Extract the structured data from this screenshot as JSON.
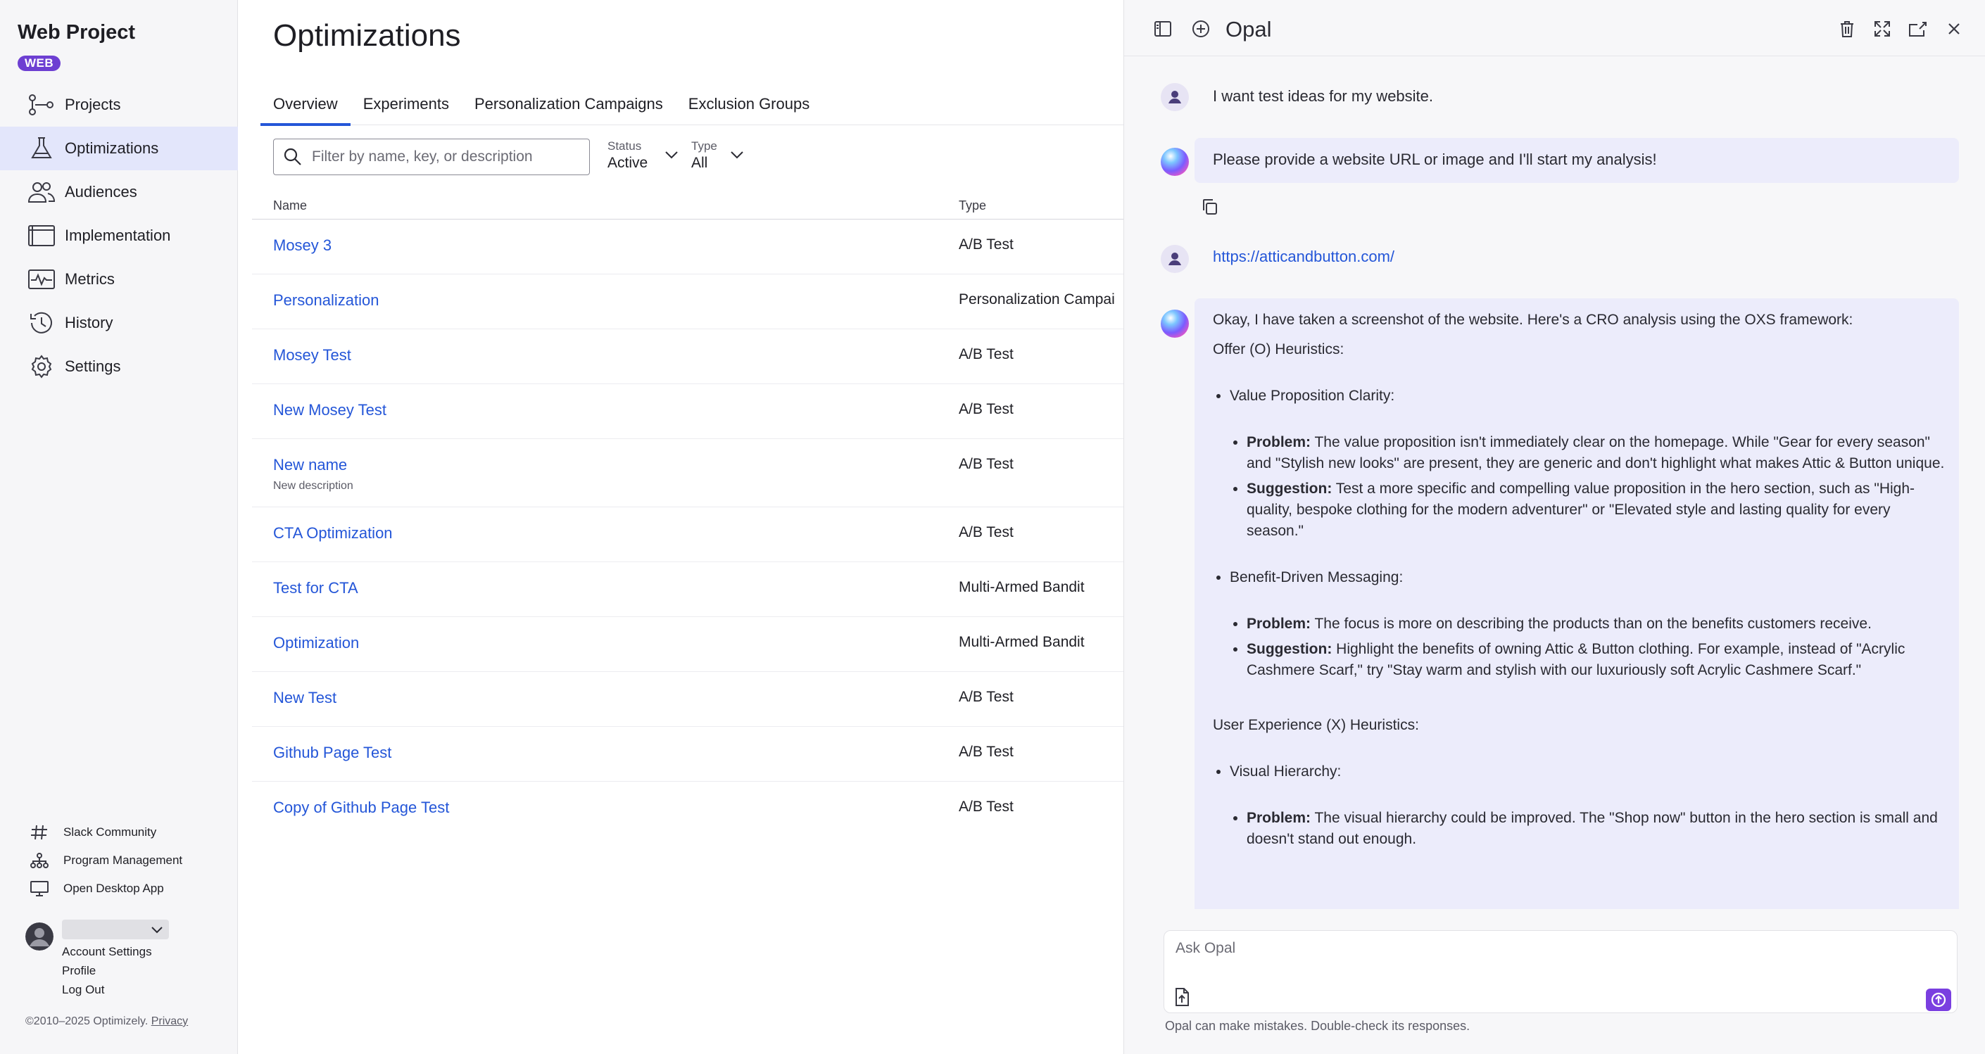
{
  "sidebar": {
    "project_title": "Web Project",
    "badge": "WEB",
    "nav": [
      {
        "label": "Projects",
        "icon": "projects-icon"
      },
      {
        "label": "Optimizations",
        "icon": "flask-icon"
      },
      {
        "label": "Audiences",
        "icon": "audiences-icon"
      },
      {
        "label": "Implementation",
        "icon": "implementation-icon"
      },
      {
        "label": "Metrics",
        "icon": "metrics-icon"
      },
      {
        "label": "History",
        "icon": "history-icon"
      },
      {
        "label": "Settings",
        "icon": "gear-icon"
      }
    ],
    "links": [
      {
        "label": "Slack Community",
        "icon": "hash-icon"
      },
      {
        "label": "Program Management",
        "icon": "org-chart-icon"
      },
      {
        "label": "Open Desktop App",
        "icon": "monitor-icon"
      }
    ],
    "account_menu": [
      "Account Settings",
      "Profile",
      "Log Out"
    ],
    "copyright": "©2010–2025 Optimizely.",
    "privacy_link": "Privacy",
    "accent_color": "#6d3fd2",
    "active_bg": "#e3e6fb"
  },
  "main": {
    "title": "Optimizations",
    "tabs": [
      "Overview",
      "Experiments",
      "Personalization Campaigns",
      "Exclusion Groups"
    ],
    "search_placeholder": "Filter by name, key, or description",
    "filters": {
      "status_label": "Status",
      "status_value": "Active",
      "type_label": "Type",
      "type_value": "All"
    },
    "columns": {
      "name": "Name",
      "type": "Type"
    },
    "rows": [
      {
        "name": "Mosey 3",
        "description": "",
        "type": "A/B Test"
      },
      {
        "name": "Personalization",
        "description": "",
        "type": "Personalization Campai"
      },
      {
        "name": "Mosey Test",
        "description": "",
        "type": "A/B Test"
      },
      {
        "name": "New Mosey Test",
        "description": "",
        "type": "A/B Test"
      },
      {
        "name": "New name",
        "description": "New description",
        "type": "A/B Test"
      },
      {
        "name": "CTA Optimization",
        "description": "",
        "type": "A/B Test"
      },
      {
        "name": "Test for CTA",
        "description": "",
        "type": "Multi-Armed Bandit"
      },
      {
        "name": "Optimization",
        "description": "",
        "type": "Multi-Armed Bandit"
      },
      {
        "name": "New Test",
        "description": "",
        "type": "A/B Test"
      },
      {
        "name": "Github Page Test",
        "description": "",
        "type": "A/B Test"
      },
      {
        "name": "Copy of Github Page Test",
        "description": "",
        "type": "A/B Test"
      }
    ],
    "link_color": "#2456d8"
  },
  "opal": {
    "title": "Opal",
    "messages": {
      "user_1": "I want test ideas for my website.",
      "ai_1": "Please provide a website URL or image and I'll start my analysis!",
      "user_2": "https://atticandbutton.com/",
      "ai_2_intro": "Okay, I have taken a screenshot of the website. Here's a CRO analysis using the OXS framework:",
      "offer_heading": "Offer (O) Heuristics:",
      "item_1": "Value Proposition Clarity:",
      "problem_label": "Problem:",
      "suggestion_label": "Suggestion:",
      "item_1_problem": "The value proposition isn't immediately clear on the homepage. While \"Gear for every season\" and \"Stylish new looks\" are present, they are generic and don't highlight what makes Attic & Button unique.",
      "item_1_suggestion": "Test a more specific and compelling value proposition in the hero section, such as \"High-quality, bespoke clothing for the modern adventurer\" or \"Elevated style and lasting quality for every season.\"",
      "item_2": "Benefit-Driven Messaging:",
      "item_2_problem": "The focus is more on describing the products than on the benefits customers receive.",
      "item_2_suggestion": "Highlight the benefits of owning Attic & Button clothing. For example, instead of \"Acrylic Cashmere Scarf,\" try \"Stay warm and stylish with our luxuriously soft Acrylic Cashmere Scarf.\"",
      "ux_heading": "User Experience (X) Heuristics:",
      "item_3": "Visual Hierarchy:",
      "item_3_problem": "The visual hierarchy could be improved. The \"Shop now\" button in the hero section is small and doesn't stand out enough."
    },
    "input_placeholder": "Ask Opal",
    "disclaimer": "Opal can make mistakes. Double-check its responses.",
    "send_color": "#7a3fe0"
  }
}
